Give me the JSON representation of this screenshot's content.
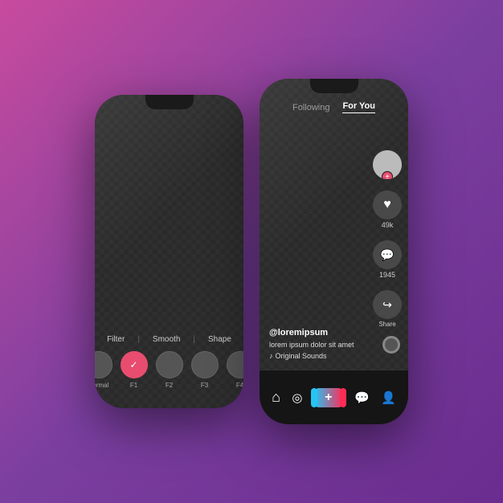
{
  "background": {
    "gradient_start": "#c84b9e",
    "gradient_end": "#6a2d8f"
  },
  "phone_left": {
    "filter_bar": {
      "items": [
        "Filter",
        "Smooth",
        "Shape"
      ],
      "divider": "|"
    },
    "filter_circles": [
      {
        "label": "Normal",
        "active": false
      },
      {
        "label": "F1",
        "active": true,
        "check": "✓"
      },
      {
        "label": "F2",
        "active": false
      },
      {
        "label": "F3",
        "active": false
      },
      {
        "label": "F4",
        "active": false
      }
    ]
  },
  "phone_right": {
    "nav_tabs": [
      {
        "label": "Following",
        "active": false
      },
      {
        "label": "For You",
        "active": true
      }
    ],
    "side_actions": [
      {
        "type": "avatar",
        "has_plus": true
      },
      {
        "type": "like",
        "icon": "♥",
        "count": "49k"
      },
      {
        "type": "comment",
        "icon": "💬",
        "count": "1945"
      },
      {
        "type": "share",
        "icon": "↪",
        "label": "Share"
      }
    ],
    "video_info": {
      "username": "@loremipsum",
      "description": "lorem ipsum dolor sit amet",
      "sound": "Original Sounds"
    },
    "bottom_nav": {
      "items": [
        "home",
        "discover",
        "plus",
        "chat",
        "profile"
      ]
    }
  }
}
